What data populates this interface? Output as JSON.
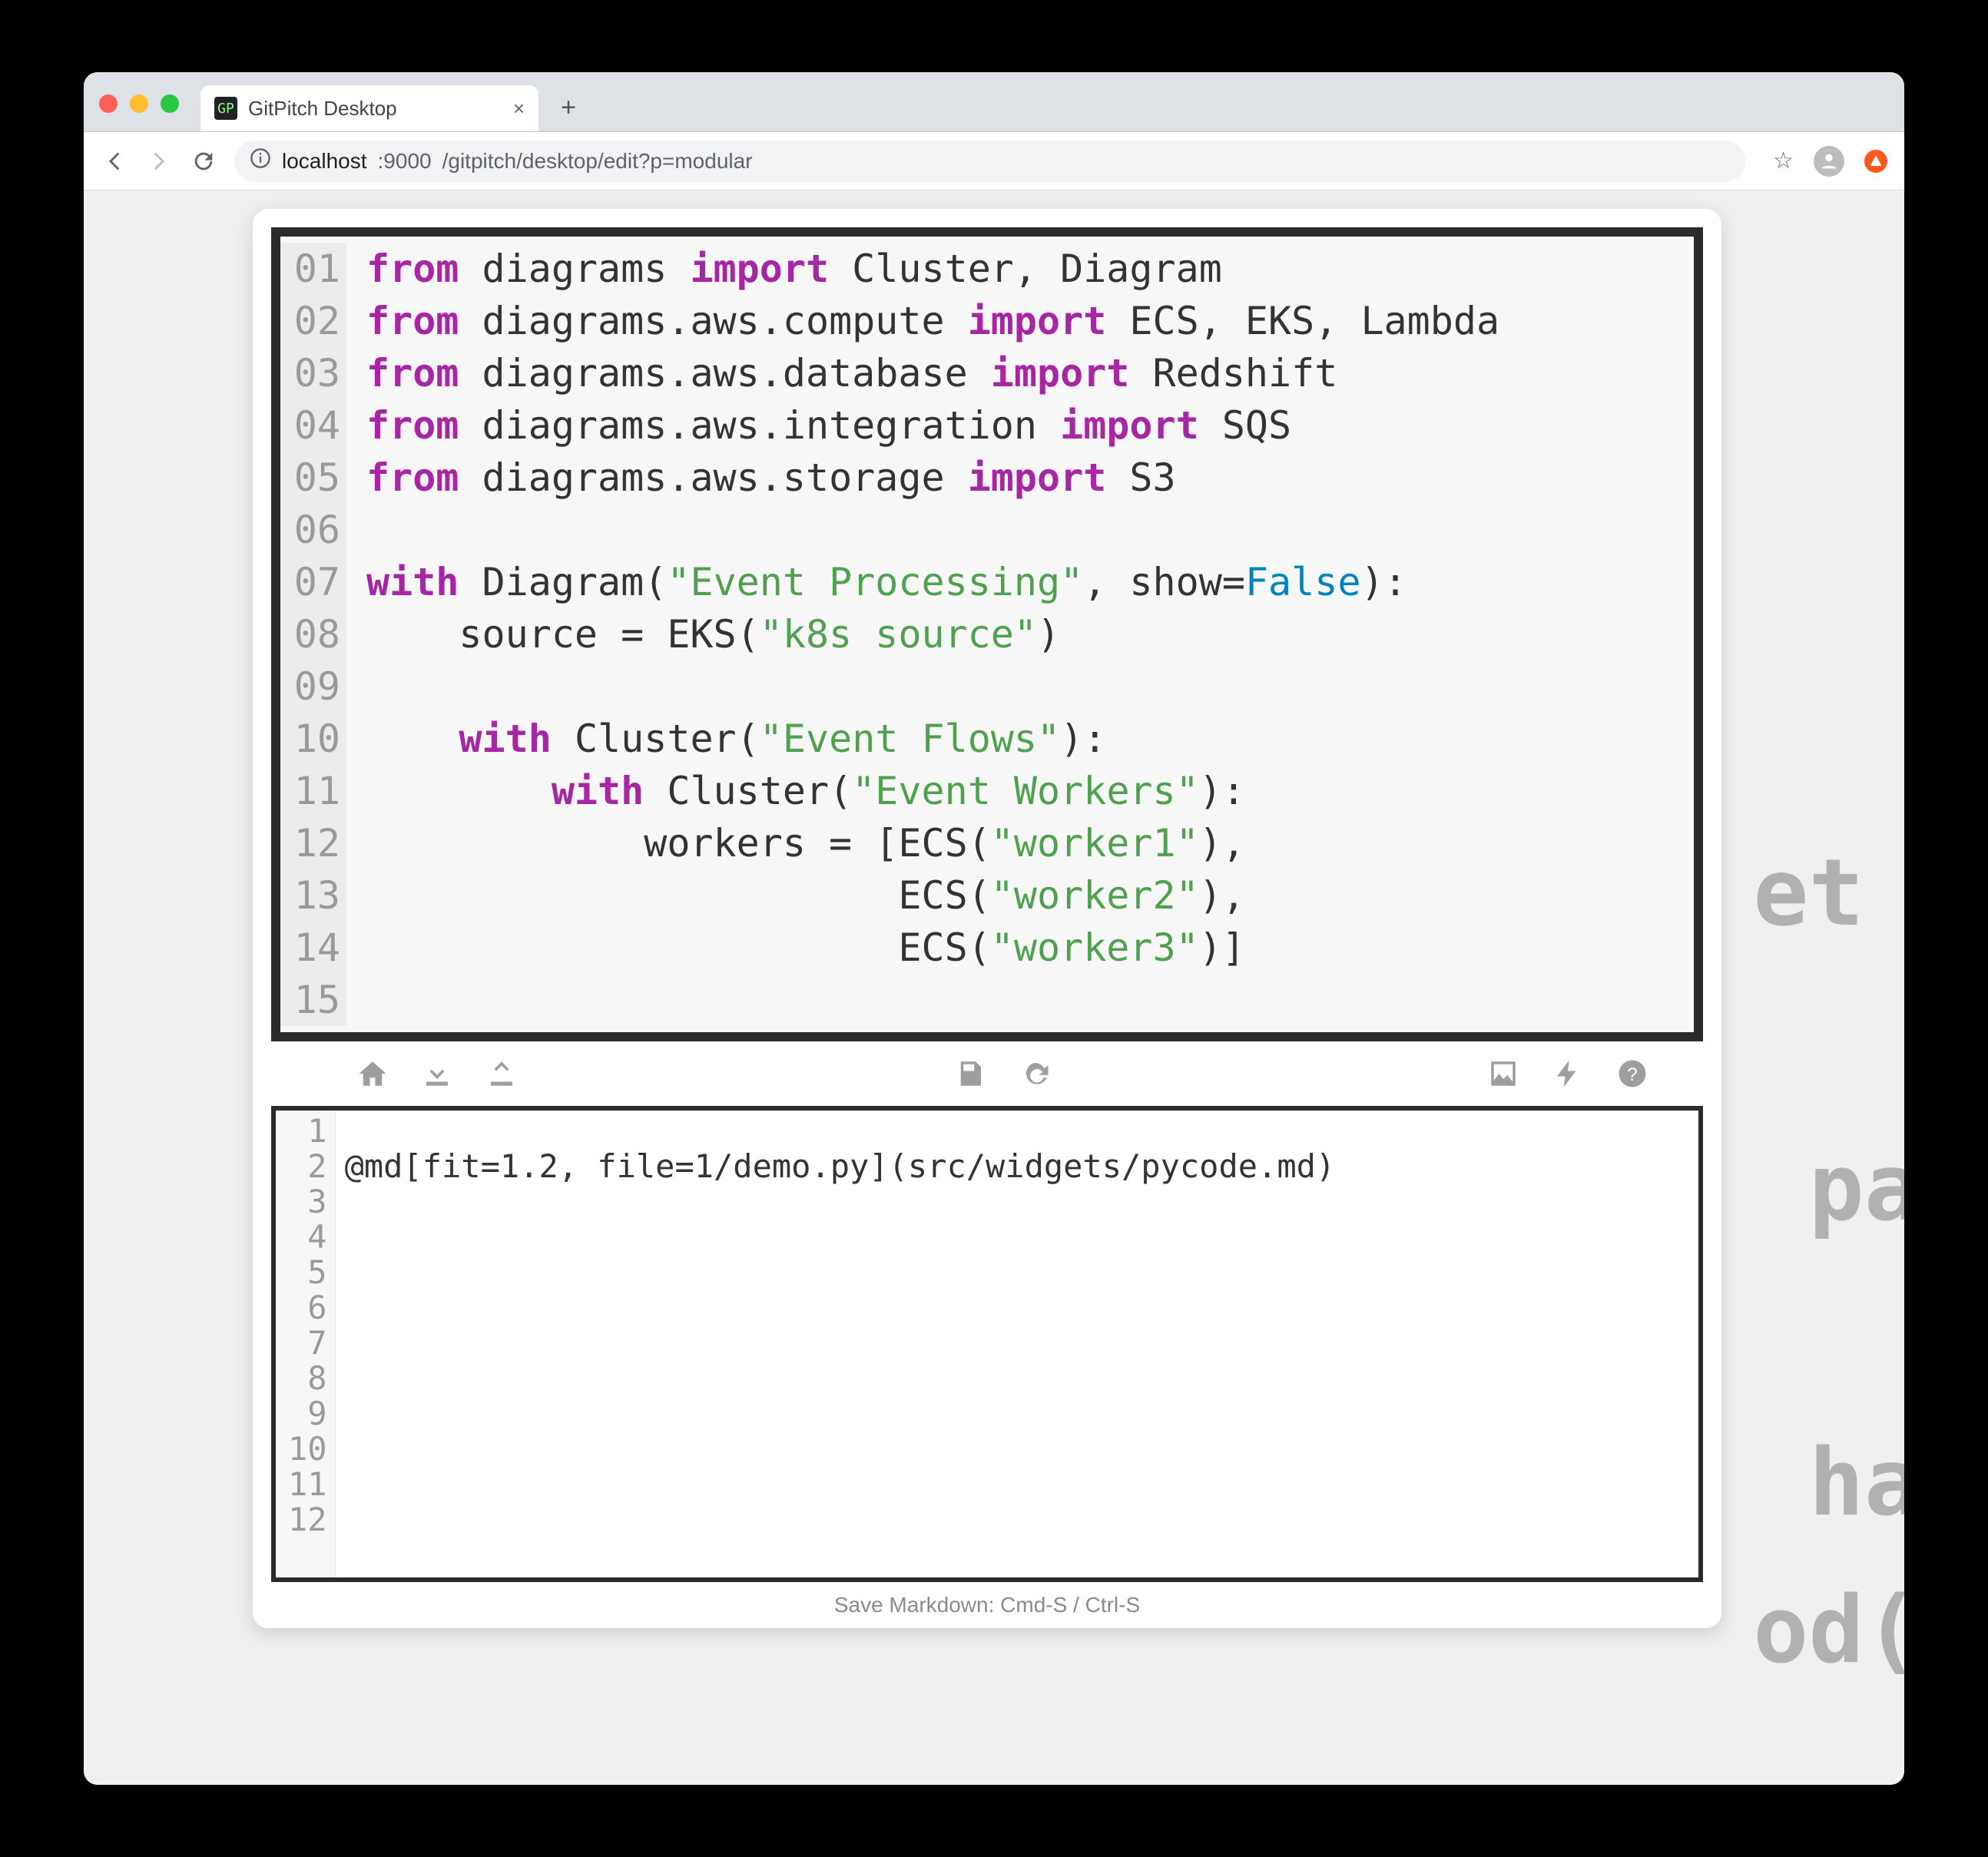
{
  "browser": {
    "tab": {
      "favicon_label": "GP",
      "title": "GitPitch Desktop"
    },
    "url": {
      "host": "localhost",
      "port": ":9000",
      "path": "/gitpitch/desktop/edit?p=modular"
    }
  },
  "preview": {
    "lines": [
      {
        "n": "01",
        "segments": [
          {
            "cls": "kw",
            "t": "from"
          },
          {
            "cls": "",
            "t": " diagrams "
          },
          {
            "cls": "kw",
            "t": "import"
          },
          {
            "cls": "",
            "t": " Cluster, Diagram"
          }
        ]
      },
      {
        "n": "02",
        "segments": [
          {
            "cls": "kw",
            "t": "from"
          },
          {
            "cls": "",
            "t": " diagrams.aws.compute "
          },
          {
            "cls": "kw",
            "t": "import"
          },
          {
            "cls": "",
            "t": " ECS, EKS, Lambda"
          }
        ]
      },
      {
        "n": "03",
        "segments": [
          {
            "cls": "kw",
            "t": "from"
          },
          {
            "cls": "",
            "t": " diagrams.aws.database "
          },
          {
            "cls": "kw",
            "t": "import"
          },
          {
            "cls": "",
            "t": " Redshift"
          }
        ]
      },
      {
        "n": "04",
        "segments": [
          {
            "cls": "kw",
            "t": "from"
          },
          {
            "cls": "",
            "t": " diagrams.aws.integration "
          },
          {
            "cls": "kw",
            "t": "import"
          },
          {
            "cls": "",
            "t": " SQS"
          }
        ]
      },
      {
        "n": "05",
        "segments": [
          {
            "cls": "kw",
            "t": "from"
          },
          {
            "cls": "",
            "t": " diagrams.aws.storage "
          },
          {
            "cls": "kw",
            "t": "import"
          },
          {
            "cls": "",
            "t": " S3"
          }
        ]
      },
      {
        "n": "06",
        "segments": [
          {
            "cls": "",
            "t": " "
          }
        ]
      },
      {
        "n": "07",
        "segments": [
          {
            "cls": "kw",
            "t": "with"
          },
          {
            "cls": "",
            "t": " Diagram("
          },
          {
            "cls": "str",
            "t": "\"Event Processing\""
          },
          {
            "cls": "",
            "t": ", show="
          },
          {
            "cls": "bool",
            "t": "False"
          },
          {
            "cls": "",
            "t": "):"
          }
        ]
      },
      {
        "n": "08",
        "segments": [
          {
            "cls": "",
            "t": "    source = EKS("
          },
          {
            "cls": "str",
            "t": "\"k8s source\""
          },
          {
            "cls": "",
            "t": ")"
          }
        ]
      },
      {
        "n": "09",
        "segments": [
          {
            "cls": "",
            "t": " "
          }
        ]
      },
      {
        "n": "10",
        "segments": [
          {
            "cls": "",
            "t": "    "
          },
          {
            "cls": "kw",
            "t": "with"
          },
          {
            "cls": "",
            "t": " Cluster("
          },
          {
            "cls": "str",
            "t": "\"Event Flows\""
          },
          {
            "cls": "",
            "t": "):"
          }
        ]
      },
      {
        "n": "11",
        "segments": [
          {
            "cls": "",
            "t": "        "
          },
          {
            "cls": "kw",
            "t": "with"
          },
          {
            "cls": "",
            "t": " Cluster("
          },
          {
            "cls": "str",
            "t": "\"Event Workers\""
          },
          {
            "cls": "",
            "t": "):"
          }
        ]
      },
      {
        "n": "12",
        "segments": [
          {
            "cls": "",
            "t": "            workers = [ECS("
          },
          {
            "cls": "str",
            "t": "\"worker1\""
          },
          {
            "cls": "",
            "t": "),"
          }
        ]
      },
      {
        "n": "13",
        "segments": [
          {
            "cls": "",
            "t": "                       ECS("
          },
          {
            "cls": "str",
            "t": "\"worker2\""
          },
          {
            "cls": "",
            "t": "),"
          }
        ]
      },
      {
        "n": "14",
        "segments": [
          {
            "cls": "",
            "t": "                       ECS("
          },
          {
            "cls": "str",
            "t": "\"worker3\""
          },
          {
            "cls": "",
            "t": ")]"
          }
        ]
      },
      {
        "n": "15",
        "segments": [
          {
            "cls": "",
            "t": " "
          }
        ]
      }
    ]
  },
  "toolbar": {
    "home": "home-icon",
    "download": "download-icon",
    "upload": "upload-icon",
    "save": "save-icon",
    "refresh": "refresh-icon",
    "image": "image-icon",
    "bolt": "bolt-icon",
    "help": "help-icon"
  },
  "editor": {
    "gutter": [
      "1",
      "2",
      "3",
      "4",
      "5",
      "6",
      "7",
      "8",
      "9",
      "10",
      "11",
      "12"
    ],
    "lines": [
      "",
      "@md[fit=1.2, file=1/demo.py](src/widgets/pycode.md)",
      "",
      "",
      "",
      "",
      "",
      "",
      "",
      "",
      "",
      ""
    ]
  },
  "status": "Save Markdown: Cmd-S / Ctrl-S",
  "bg_lines": [
    "et ",
    "",
    "pa",
    "",
    "ha",
    "od("
  ]
}
